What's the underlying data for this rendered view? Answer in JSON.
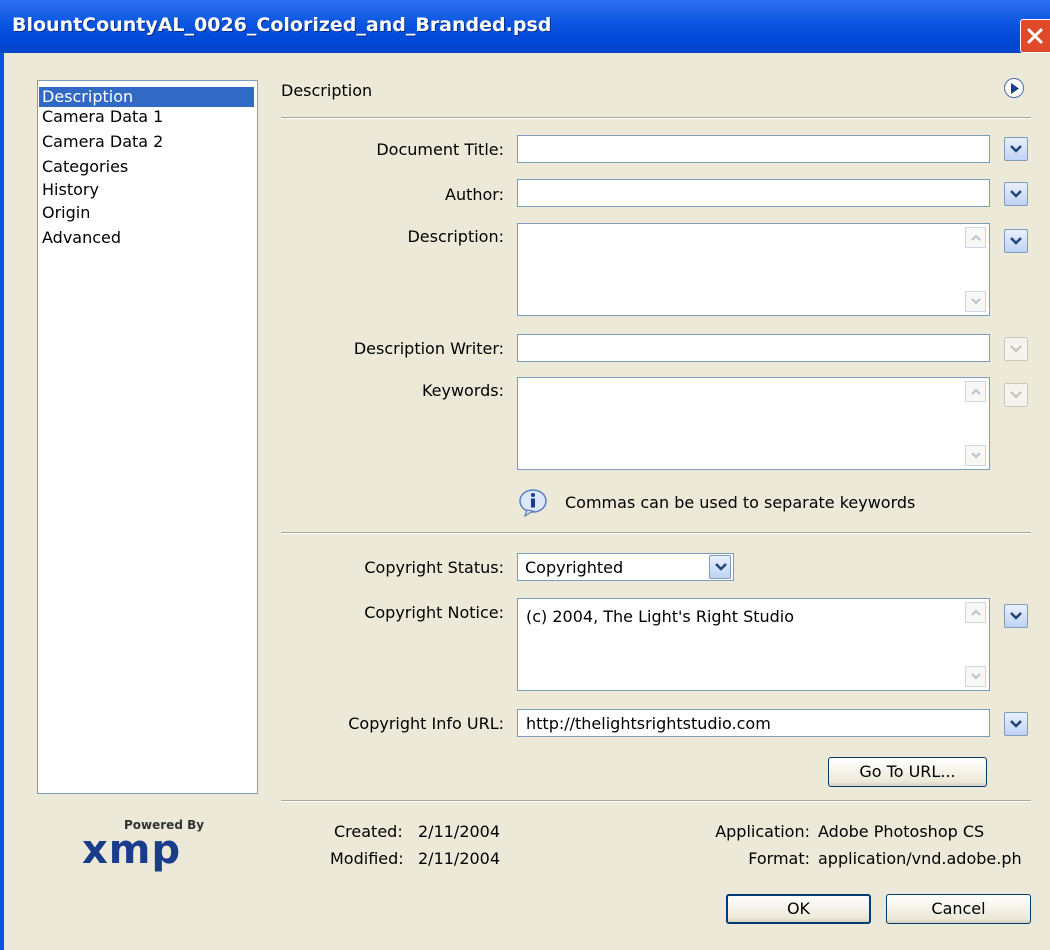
{
  "window": {
    "title": "BlountCountyAL_0026_Colorized_and_Branded.psd"
  },
  "nav": {
    "items": [
      "Description",
      "Camera Data 1",
      "Camera Data 2",
      "Categories",
      "History",
      "Origin",
      "Advanced"
    ]
  },
  "panel": {
    "title": "Description"
  },
  "fields": {
    "document_title": {
      "label": "Document Title:",
      "value": ""
    },
    "author": {
      "label": "Author:",
      "value": ""
    },
    "description": {
      "label": "Description:",
      "value": ""
    },
    "description_writer": {
      "label": "Description Writer:",
      "value": ""
    },
    "keywords": {
      "label": "Keywords:",
      "value": ""
    }
  },
  "info": {
    "text": "Commas can be used to separate keywords"
  },
  "copyright": {
    "status_label": "Copyright Status:",
    "status_value": "Copyrighted",
    "notice_label": "Copyright Notice:",
    "notice_value": "(c) 2004, The Light's Right Studio",
    "url_label": "Copyright Info URL:",
    "url_value": "http://thelightsrightstudio.com",
    "go_button": "Go To URL..."
  },
  "logo": {
    "powered_by": "Powered By",
    "name": "xmp"
  },
  "meta": {
    "created_label": "Created:",
    "created_value": "2/11/2004",
    "modified_label": "Modified:",
    "modified_value": "2/11/2004",
    "application_label": "Application:",
    "application_value": "Adobe Photoshop CS",
    "format_label": "Format:",
    "format_value": "application/vnd.adobe.ph"
  },
  "buttons": {
    "ok": "OK",
    "cancel": "Cancel"
  },
  "colors": {
    "titlebar": "#0a55e0",
    "selection": "#316ac5",
    "dialog_bg": "#ece9d8",
    "close": "#e04a2a"
  }
}
